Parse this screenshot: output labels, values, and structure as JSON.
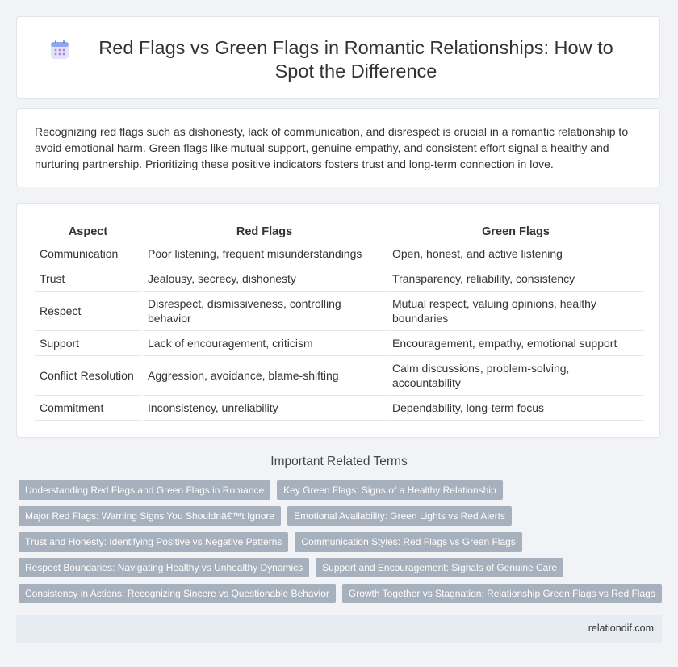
{
  "header": {
    "title": "Red Flags vs Green Flags in Romantic Relationships: How to Spot the Difference",
    "icon": "calendar-icon"
  },
  "intro": {
    "text": "Recognizing red flags such as dishonesty, lack of communication, and disrespect is crucial in a romantic relationship to avoid emotional harm. Green flags like mutual support, genuine empathy, and consistent effort signal a healthy and nurturing partnership. Prioritizing these positive indicators fosters trust and long-term connection in love."
  },
  "table": {
    "headers": [
      "Aspect",
      "Red Flags",
      "Green Flags"
    ],
    "rows": [
      [
        "Communication",
        "Poor listening, frequent misunderstandings",
        "Open, honest, and active listening"
      ],
      [
        "Trust",
        "Jealousy, secrecy, dishonesty",
        "Transparency, reliability, consistency"
      ],
      [
        "Respect",
        "Disrespect, dismissiveness, controlling behavior",
        "Mutual respect, valuing opinions, healthy boundaries"
      ],
      [
        "Support",
        "Lack of encouragement, criticism",
        "Encouragement, empathy, emotional support"
      ],
      [
        "Conflict Resolution",
        "Aggression, avoidance, blame-shifting",
        "Calm discussions, problem-solving, accountability"
      ],
      [
        "Commitment",
        "Inconsistency, unreliability",
        "Dependability, long-term focus"
      ]
    ]
  },
  "related": {
    "title": "Important Related Terms",
    "rows": [
      [
        "Understanding Red Flags and Green Flags in Romance",
        "Key Green Flags: Signs of a Healthy Relationship"
      ],
      [
        "Major Red Flags: Warning Signs You Shouldnâ€™t Ignore",
        "Emotional Availability: Green Lights vs Red Alerts"
      ],
      [
        "Trust and Honesty: Identifying Positive vs Negative Patterns",
        "Communication Styles: Red Flags vs Green Flags"
      ],
      [
        "Respect Boundaries: Navigating Healthy vs Unhealthy Dynamics",
        "Support and Encouragement: Signals of Genuine Care"
      ],
      [
        "Consistency in Actions: Recognizing Sincere vs Questionable Behavior",
        "Growth Together vs Stagnation: Relationship Green Flags vs Red Flags"
      ]
    ]
  },
  "footer": {
    "site": "relationdif.com"
  },
  "colors": {
    "tag_bg": "#a7b0bd",
    "page_bg": "#f1f3f6",
    "footer_bg": "#e7ebf2"
  }
}
